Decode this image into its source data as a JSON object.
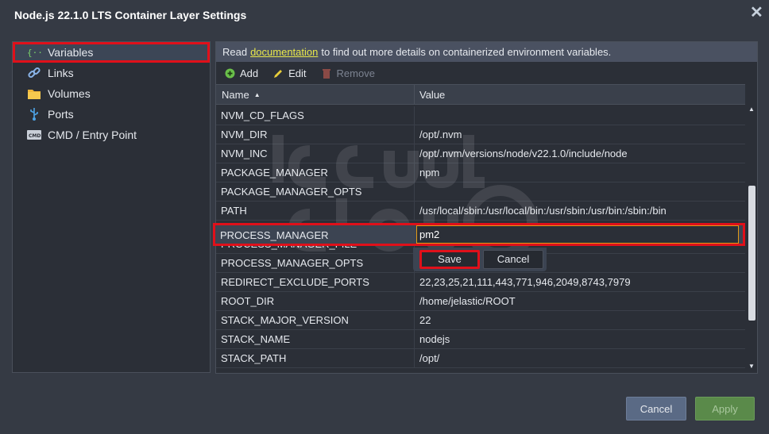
{
  "window": {
    "title": "Node.js 22.1.0 LTS Container Layer Settings",
    "close_icon": "close-icon"
  },
  "nav": {
    "items": [
      {
        "label": "Variables",
        "icon": "braces-icon"
      },
      {
        "label": "Links",
        "icon": "link-icon"
      },
      {
        "label": "Volumes",
        "icon": "folder-icon"
      },
      {
        "label": "Ports",
        "icon": "usb-icon"
      },
      {
        "label": "CMD / Entry Point",
        "icon": "cmd-icon"
      }
    ],
    "selected": "Variables"
  },
  "info": {
    "prefix": "Read",
    "link": "documentation",
    "suffix": "to find out more details on containerized environment variables."
  },
  "toolbar": {
    "add": "Add",
    "edit": "Edit",
    "remove": "Remove"
  },
  "grid": {
    "headers": {
      "name": "Name",
      "value": "Value"
    },
    "rows": [
      {
        "name": "NVM_CD_FLAGS",
        "value": ""
      },
      {
        "name": "NVM_DIR",
        "value": "/opt/.nvm"
      },
      {
        "name": "NVM_INC",
        "value": "/opt/.nvm/versions/node/v22.1.0/include/node"
      },
      {
        "name": "PACKAGE_MANAGER",
        "value": "npm"
      },
      {
        "name": "PACKAGE_MANAGER_OPTS",
        "value": ""
      },
      {
        "name": "PATH",
        "value": "/usr/local/sbin:/usr/local/bin:/usr/sbin:/usr/bin:/sbin:/bin"
      },
      {
        "name": "PROCESS_MANAGER",
        "value": "pm2"
      },
      {
        "name": "PROCESS_MANAGER_FILE",
        "value": ""
      },
      {
        "name": "PROCESS_MANAGER_OPTS",
        "value": ""
      },
      {
        "name": "REDIRECT_EXCLUDE_PORTS",
        "value": "22,23,25,21,111,443,771,946,2049,8743,7979"
      },
      {
        "name": "ROOT_DIR",
        "value": "/home/jelastic/ROOT"
      },
      {
        "name": "STACK_MAJOR_VERSION",
        "value": "22"
      },
      {
        "name": "STACK_NAME",
        "value": "nodejs"
      },
      {
        "name": "STACK_PATH",
        "value": "/opt/"
      }
    ]
  },
  "editor": {
    "name": "PROCESS_MANAGER",
    "value": "pm2",
    "save": "Save",
    "cancel": "Cancel"
  },
  "footer": {
    "cancel": "Cancel",
    "apply": "Apply"
  },
  "colors": {
    "highlight": "#e0101a",
    "link": "#e8e84a",
    "apply": "#5a8a4a"
  }
}
